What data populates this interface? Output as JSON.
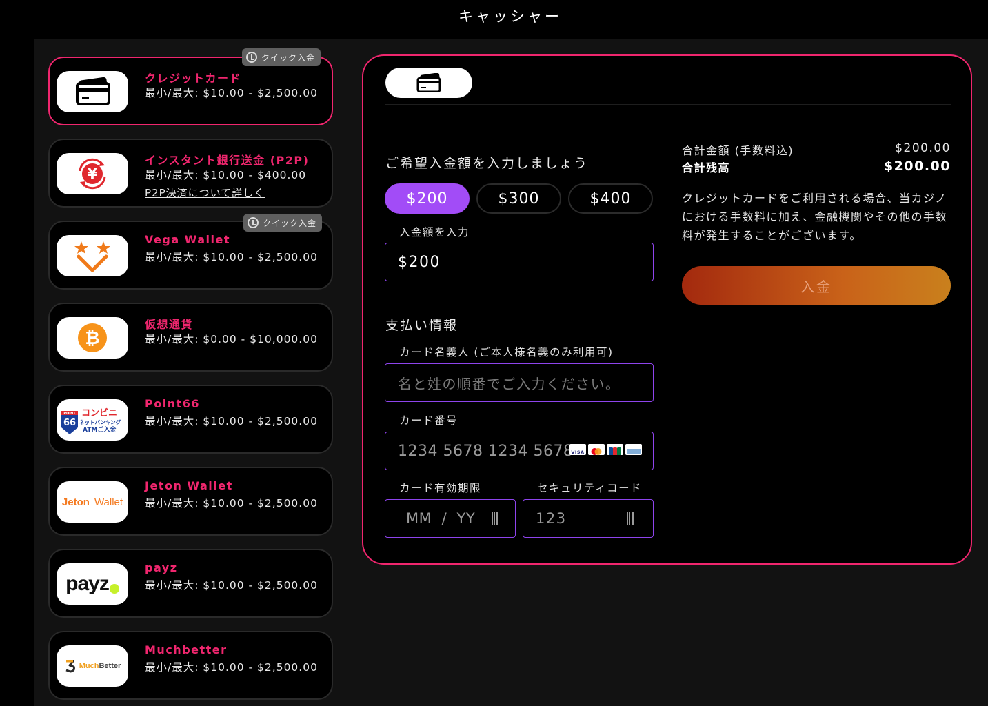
{
  "header": {
    "title": "キャッシャー"
  },
  "quick_label": "クイック入金",
  "methods": [
    {
      "name": "クレジットカード",
      "range": "最小/最大: $10.00 - $2,500.00",
      "icon": "credit-card-icon"
    },
    {
      "name": "インスタント銀行送金 (P2P)",
      "range": "最小/最大: $10.00 - $400.00",
      "link": "P2P決済について詳しく",
      "icon": "yen-transfer-icon"
    },
    {
      "name": "Vega Wallet",
      "range": "最小/最大: $10.00 - $2,500.00",
      "icon": "vega-wallet-icon"
    },
    {
      "name": "仮想通貨",
      "range": "最小/最大: $0.00 - $10,000.00",
      "icon": "bitcoin-icon"
    },
    {
      "name": "Point66",
      "range": "最小/最大: $10.00 - $2,500.00",
      "icon": "point66-logo",
      "logo_lines": [
        "POINT",
        "66",
        "コンビニ",
        "ネットバンキング",
        "ATMご入金"
      ]
    },
    {
      "name": "Jeton Wallet",
      "range": "最小/最大: $10.00 - $2,500.00",
      "icon": "jeton-logo",
      "logo_text": {
        "brand": "Jeton",
        "suffix": "Wallet"
      }
    },
    {
      "name": "payz",
      "range": "最小/最大: $10.00 - $2,500.00",
      "icon": "payz-logo",
      "logo_text": "payz"
    },
    {
      "name": "Muchbetter",
      "range": "最小/最大: $10.00 - $2,500.00",
      "icon": "muchbetter-logo",
      "logo_text": {
        "brand": "Much",
        "suffix": "Better"
      }
    }
  ],
  "form": {
    "amount_title": "ご希望入金額を入力しましょう",
    "amount_options": [
      "$200",
      "$300",
      "$400"
    ],
    "selected_amount": "$200",
    "amount_input_label": "入金額を入力",
    "amount_value": "$200",
    "payment_title": "支払い情報",
    "card_holder_label": "カード名義人 (ご本人様名義のみ利用可)",
    "card_holder_placeholder": "名と姓の順番でご入力ください。",
    "card_number_label": "カード番号",
    "card_number_placeholder": "1234 5678 1234 5678",
    "expiry_label": "カード有効期限",
    "expiry_placeholder": "MM  /  YY",
    "cvv_label": "セキュリティコード",
    "cvv_placeholder": "123",
    "card_brands": [
      "VISA",
      "Mastercard",
      "JCB",
      "AMEX"
    ]
  },
  "summary": {
    "total_label": "合計金額 (手数料込)",
    "total_value": "$200.00",
    "balance_label": "合計残高",
    "balance_value": "$200.00",
    "note": "クレジットカードをご利用される場合、当カジノにおける手数料に加え、金融機関やその他の手数料が発生することがございます。",
    "deposit_button": "入金"
  },
  "colors": {
    "accent": "#f0266e",
    "selected": "#a24cf7",
    "input_border": "#8e44ec"
  }
}
